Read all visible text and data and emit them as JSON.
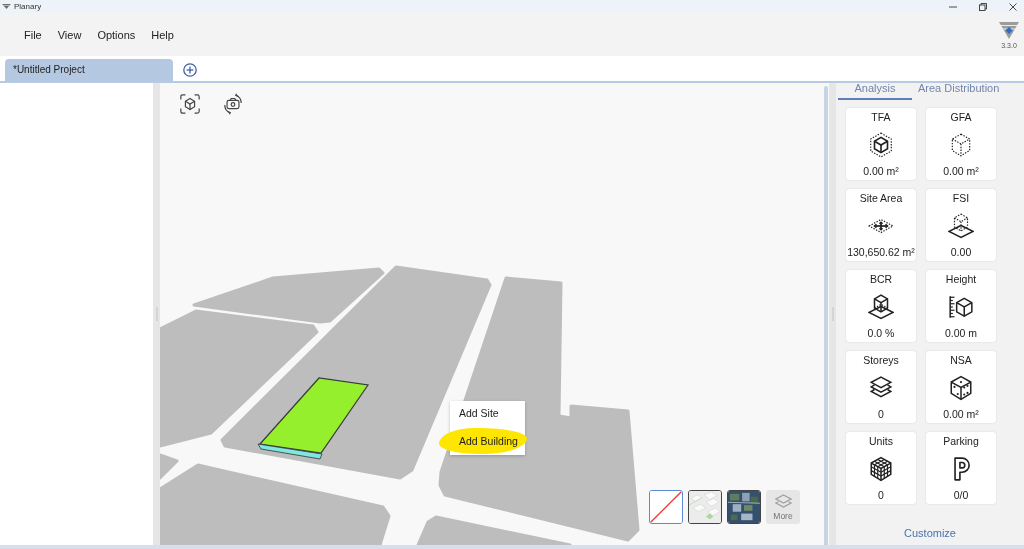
{
  "window": {
    "title": "Planary",
    "version": "3.3.0"
  },
  "menu": [
    "File",
    "View",
    "Options",
    "Help"
  ],
  "project_tabs": [
    {
      "label": "*Untitled Project",
      "selected": true
    }
  ],
  "viewport": {
    "context_menu": [
      {
        "label": "Add Site",
        "highlighted": false
      },
      {
        "label": "Add Building",
        "highlighted": true
      }
    ],
    "basemaps": [
      {
        "kind": "none",
        "selected": true,
        "disabled": false
      },
      {
        "kind": "street",
        "selected": false,
        "disabled": false
      },
      {
        "kind": "satellite",
        "selected": false,
        "disabled": false
      },
      {
        "kind": "more",
        "label": "More",
        "selected": false,
        "disabled": true
      }
    ]
  },
  "panel": {
    "tabs": [
      {
        "label": "Analysis",
        "selected": true
      },
      {
        "label": "Area Distribution",
        "selected": false
      }
    ],
    "metrics": [
      {
        "kind": "tfa",
        "title": "TFA",
        "reading": "0.00 m²"
      },
      {
        "kind": "gfa",
        "title": "GFA",
        "reading": "0.00 m²"
      },
      {
        "kind": "site_area",
        "title": "Site Area",
        "reading": "130,650.62 m²"
      },
      {
        "kind": "fsi",
        "title": "FSI",
        "reading": "0.00"
      },
      {
        "kind": "bcr",
        "title": "BCR",
        "reading": "0.0 %"
      },
      {
        "kind": "height",
        "title": "Height",
        "reading": "0.00 m"
      },
      {
        "kind": "storeys",
        "title": "Storeys",
        "reading": "0"
      },
      {
        "kind": "nsa",
        "title": "NSA",
        "reading": "0.00 m²"
      },
      {
        "kind": "units",
        "title": "Units",
        "reading": "0"
      },
      {
        "kind": "parking",
        "title": "Parking",
        "reading": "0/0"
      }
    ],
    "customize": "Customize"
  }
}
